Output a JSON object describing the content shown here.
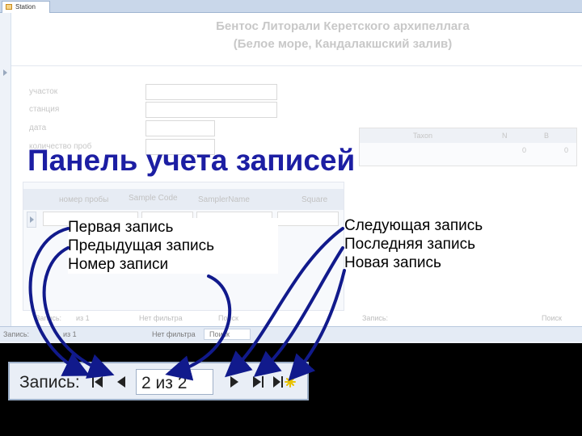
{
  "window": {
    "tab_label": "Station",
    "form_title_line1": "Бентос Литорали Керетского архипеллага",
    "form_title_line2": "(Белое море, Кандалакшский залив)"
  },
  "form": {
    "field_labels": [
      "участок",
      "станция",
      "дата",
      "количество проб"
    ]
  },
  "taxa_table": {
    "headers": [
      "Taxon",
      "N",
      "B"
    ],
    "row": {
      "n": "0",
      "b": "0"
    }
  },
  "subform": {
    "headers": [
      "номер пробы",
      "Sample Code",
      "SamplerName",
      "Square"
    ]
  },
  "inner_nav": {
    "record_label": "Запись:",
    "position_text": "из 1",
    "filter_text": "Нет фильтра",
    "search_placeholder": "Поиск"
  },
  "outer_nav": {
    "record_label": "Запись:",
    "position_text": "из 1",
    "filter_text": "Нет фильтра",
    "search_placeholder": "Поиск"
  },
  "overlay": {
    "title": "Панель учета записей"
  },
  "legend_left": [
    "Первая запись",
    "Предыдущая запись",
    "Номер записи"
  ],
  "legend_right": [
    "Следующая запись",
    "Последняя запись",
    "Новая запись"
  ],
  "zoom_nav": {
    "record_label": "Запись:",
    "record_position": "2 из 2",
    "icons": [
      "first-record-icon",
      "previous-record-icon",
      "next-record-icon",
      "last-record-icon",
      "new-record-icon"
    ]
  },
  "colors": {
    "overlay_title": "#1c1ea3",
    "arrow": "#111a8c",
    "new_record_star": "#e8c200"
  }
}
